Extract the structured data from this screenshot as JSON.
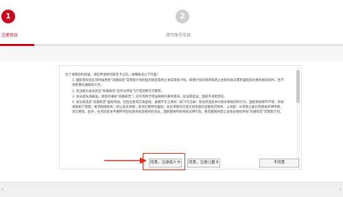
{
  "steps": [
    {
      "number": "1",
      "label": "注册协议"
    },
    {
      "number": "2",
      "label": "填写账号信息"
    }
  ],
  "agreement": {
    "paragraphs": [
      "为了保障您的权益，请在申请新的知音卡之前，详细阅读以下内容：",
      "1. 国航有权在任何时候更改\"凤凰知音\"常旅客计划的任何规定或终止本常旅客计划。即使计划的修改或终止会影响会员累积里程或兑换奖励的权利，且不承担事先通知的义务。",
      "2. 您注册为会员后在\"凤凰知音\"合作伙伴处飞行或消费方可累积。",
      "3. 会员遗失或被盗，请及时通知\"凤凰知音\"；对于因持卡错误导致的事件遗失，延误或延误，国航不承担责任。",
      "4. 会员如违反\"凤凰知音\"里程奖励，包括出售或交易里程，虚报不实之资料（如飞行记录）等任何违反本计划条款规则的行为，国航将视情节不等，有权采取如下措施：要求赔偿损失；终止会员资格；取消已累积的里程；会员须偿付已提兑的奖励的全额经济损失、公务舱、头等舱之差价及相关的律师费、诉讼费等。此外，任何违反本手册所列的任意条款及规则的会员，国航都将有权采取法律行动，要求赔偿并禁止该会员继续参加\"凤凰知音\"常旅客计划。"
    ]
  },
  "buttons": {
    "agree_adult": "同意，注册成人卡",
    "agree_child": "同意，注册儿童卡",
    "decline": "不同意"
  },
  "colors": {
    "accent": "#d0021b",
    "annotation": "#e8281c"
  }
}
